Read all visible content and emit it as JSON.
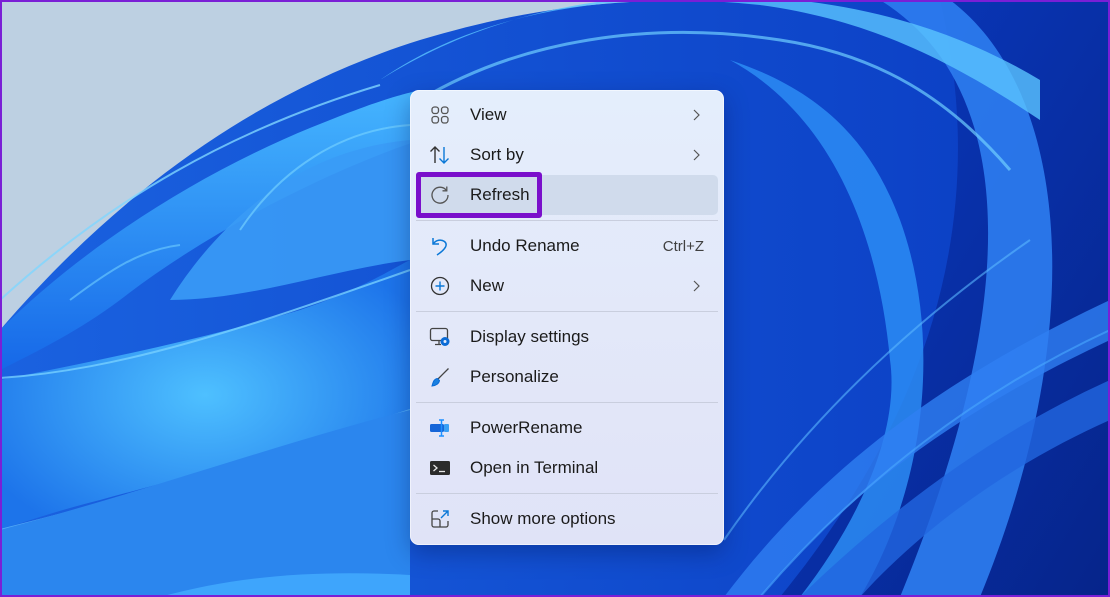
{
  "desktop": {
    "wallpaper": "Windows 11 Bloom (blue)"
  },
  "context_menu": {
    "items": [
      {
        "label": "View",
        "icon": "grid-view-icon",
        "has_submenu": true,
        "shortcut": ""
      },
      {
        "label": "Sort by",
        "icon": "sort-arrows-icon",
        "has_submenu": true,
        "shortcut": ""
      },
      {
        "label": "Refresh",
        "icon": "refresh-icon",
        "has_submenu": false,
        "shortcut": "",
        "hovered": true,
        "highlighted": true
      },
      {
        "label": "Undo Rename",
        "icon": "undo-icon",
        "has_submenu": false,
        "shortcut": "Ctrl+Z"
      },
      {
        "label": "New",
        "icon": "add-circle-icon",
        "has_submenu": true,
        "shortcut": ""
      },
      {
        "label": "Display settings",
        "icon": "display-settings-icon",
        "has_submenu": false,
        "shortcut": ""
      },
      {
        "label": "Personalize",
        "icon": "paintbrush-icon",
        "has_submenu": false,
        "shortcut": ""
      },
      {
        "label": "PowerRename",
        "icon": "powerrename-icon",
        "has_submenu": false,
        "shortcut": ""
      },
      {
        "label": "Open in Terminal",
        "icon": "terminal-icon",
        "has_submenu": false,
        "shortcut": ""
      },
      {
        "label": "Show more options",
        "icon": "show-more-options-icon",
        "has_submenu": false,
        "shortcut": ""
      }
    ]
  },
  "annotation": {
    "highlight_color": "#7a0fcb",
    "highlighted_item": "Refresh"
  },
  "colors": {
    "accent_blue": "#0067c0",
    "menu_background": "#e3ebfa",
    "frame_border": "#7a1fd6"
  }
}
